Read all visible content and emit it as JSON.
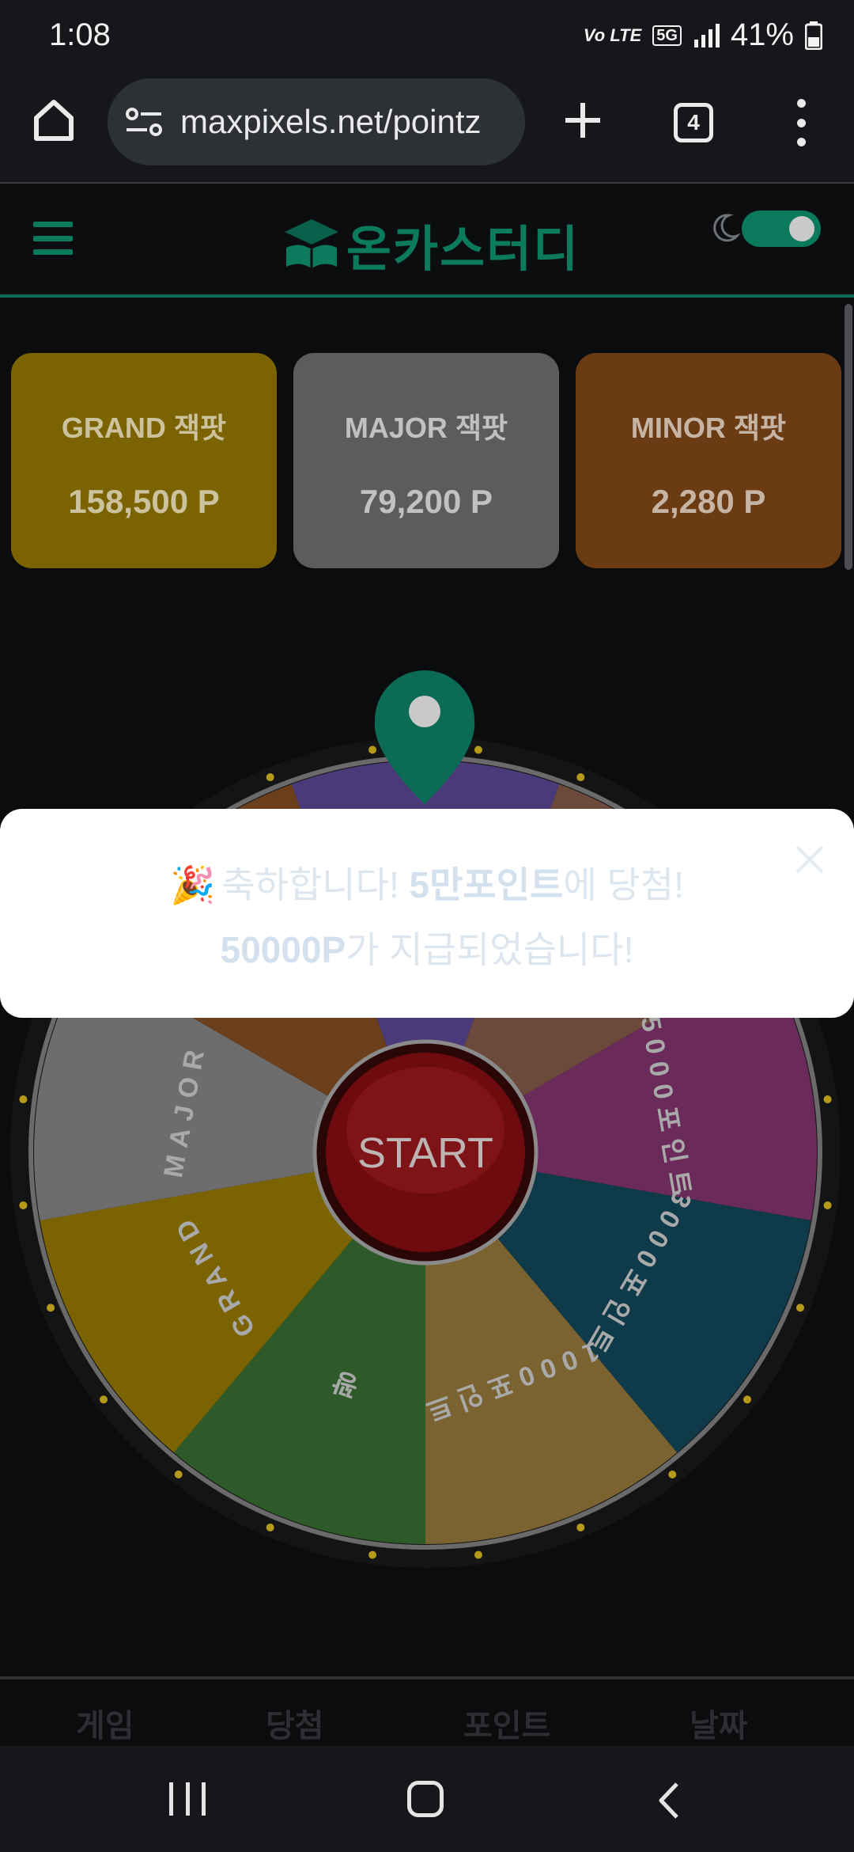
{
  "status_bar": {
    "time": "1:08",
    "network_label": "Vo LTE",
    "network_5g": "5G",
    "battery": "41%"
  },
  "browser": {
    "url": "maxpixels.net/pointz",
    "tab_count": "4",
    "icons": [
      "home-icon",
      "site-settings-icon",
      "new-tab-icon",
      "tabs-icon",
      "more-menu-icon"
    ]
  },
  "site": {
    "logo_text": "온카스터디",
    "theme_toggle": "dark-mode-on"
  },
  "jackpots": [
    {
      "label": "GRAND 잭팟",
      "value": "158,500 P",
      "color": "#7a6300"
    },
    {
      "label": "MAJOR 잭팟",
      "value": "79,200 P",
      "color": "#5c5c5c"
    },
    {
      "label": "MINOR 잭팟",
      "value": "2,280 P",
      "color": "#6b3b13"
    }
  ],
  "wheel": {
    "start_label": "START",
    "segments": [
      {
        "label": "",
        "color": "#4a3a7a"
      },
      {
        "label": "",
        "color": "#6b4a3c"
      },
      {
        "label": "5000포인트",
        "color": "#6a2a5a"
      },
      {
        "label": "3000포인트",
        "color": "#0f3a4a"
      },
      {
        "label": "1000포인트",
        "color": "#7a6330"
      },
      {
        "label": "꽝",
        "color": "#2e5a2a"
      },
      {
        "label": "GRAND",
        "color": "#7a6300"
      },
      {
        "label": "MAJOR",
        "color": "#6d6d6d"
      },
      {
        "label": "",
        "color": "#6b3f1c"
      }
    ]
  },
  "modal": {
    "emoji": "🎉",
    "line1_prefix": "축하합니다! ",
    "line1_highlight": "5만포인트",
    "line1_suffix": "에 당첨!",
    "line2_highlight": "50000P",
    "line2_suffix": "가 지급되었습니다!",
    "close_label": "×"
  },
  "bottom_tabs": [
    "게임",
    "당첨",
    "포인트",
    "날짜"
  ]
}
